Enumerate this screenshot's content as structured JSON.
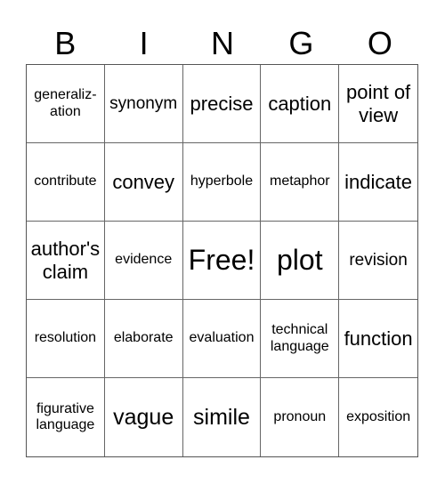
{
  "header": [
    "B",
    "I",
    "N",
    "G",
    "O"
  ],
  "cells": [
    {
      "text": "generaliz-\nation",
      "size": "s1"
    },
    {
      "text": "synonym",
      "size": "s2"
    },
    {
      "text": "precise",
      "size": "s3"
    },
    {
      "text": "caption",
      "size": "s3"
    },
    {
      "text": "point of view",
      "size": "s3"
    },
    {
      "text": "contribute",
      "size": "s1"
    },
    {
      "text": "convey",
      "size": "s3"
    },
    {
      "text": "hyperbole",
      "size": "s1"
    },
    {
      "text": "metaphor",
      "size": "s1"
    },
    {
      "text": "indicate",
      "size": "s3"
    },
    {
      "text": "author's claim",
      "size": "s3"
    },
    {
      "text": "evidence",
      "size": "s1"
    },
    {
      "text": "Free!",
      "size": "s5"
    },
    {
      "text": "plot",
      "size": "s5"
    },
    {
      "text": "revision",
      "size": "s2"
    },
    {
      "text": "resolution",
      "size": "s1"
    },
    {
      "text": "elaborate",
      "size": "s1"
    },
    {
      "text": "evaluation",
      "size": "s1"
    },
    {
      "text": "technical language",
      "size": "s1"
    },
    {
      "text": "function",
      "size": "s3"
    },
    {
      "text": "figurative language",
      "size": "s1"
    },
    {
      "text": "vague",
      "size": "s4"
    },
    {
      "text": "simile",
      "size": "s4"
    },
    {
      "text": "pronoun",
      "size": "s1"
    },
    {
      "text": "exposition",
      "size": "s1"
    }
  ]
}
